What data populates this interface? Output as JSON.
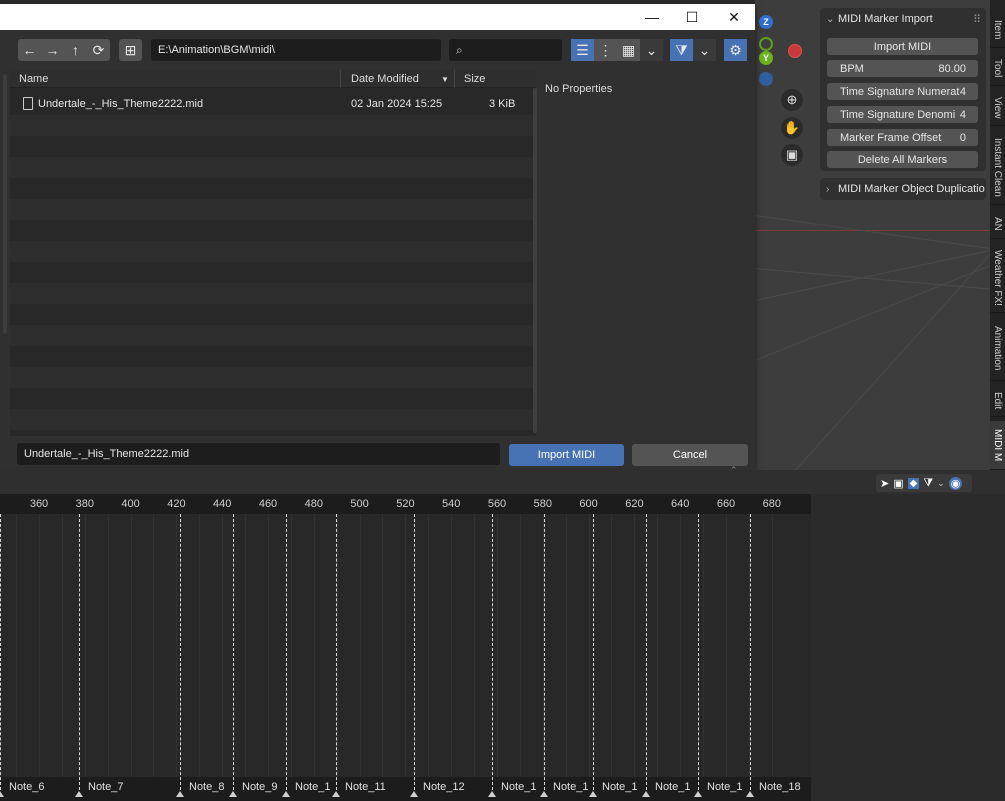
{
  "titlebar": {
    "minimize": "—",
    "maximize": "☐",
    "close": "✕"
  },
  "toolbar": {
    "path": "E:\\Animation\\BGM\\midi\\",
    "search_placeholder": ""
  },
  "filelist": {
    "columns": {
      "name": "Name",
      "date": "Date Modified",
      "size": "Size",
      "sort": "▼"
    },
    "files": [
      {
        "name": "Undertale_-_His_Theme2222.mid",
        "date": "02 Jan 2024 15:25",
        "size": "3 KiB"
      }
    ]
  },
  "properties": {
    "empty_label": "No Properties"
  },
  "bottom": {
    "filename": "Undertale_-_His_Theme2222.mid",
    "import_label": "Import MIDI",
    "cancel_label": "Cancel",
    "accent": "#4772b3"
  },
  "npanel": {
    "header": "MIDI Marker Import",
    "import_button": "Import MIDI",
    "fields": [
      {
        "label": "BPM",
        "value": "80.00"
      },
      {
        "label": "Time Signature Numerat",
        "value": "4"
      },
      {
        "label": "Time Signature Denomi",
        "value": "4"
      },
      {
        "label": "Marker Frame Offset",
        "value": "0"
      }
    ],
    "delete_button": "Delete All Markers",
    "second_header": "MIDI Marker Object Duplicatio"
  },
  "tabs": [
    "Item",
    "Tool",
    "View",
    "Instant Clean",
    "AN",
    "Weather FX!",
    "Animation",
    "Edit",
    "MIDI M"
  ],
  "gizmo": {
    "z": "Z",
    "y": "Y"
  },
  "timeline": {
    "ticks": [
      "360",
      "380",
      "400",
      "420",
      "440",
      "460",
      "480",
      "500",
      "520",
      "540",
      "560",
      "580",
      "600",
      "620",
      "640",
      "660",
      "680"
    ],
    "markers": [
      "Note_6",
      "Note_7",
      "Note_8",
      "Note_9",
      "Note_1",
      "Note_11",
      "Note_12",
      "Note_1",
      "Note_1",
      "Note_1",
      "Note_1",
      "Note_1",
      "Note_18"
    ]
  }
}
